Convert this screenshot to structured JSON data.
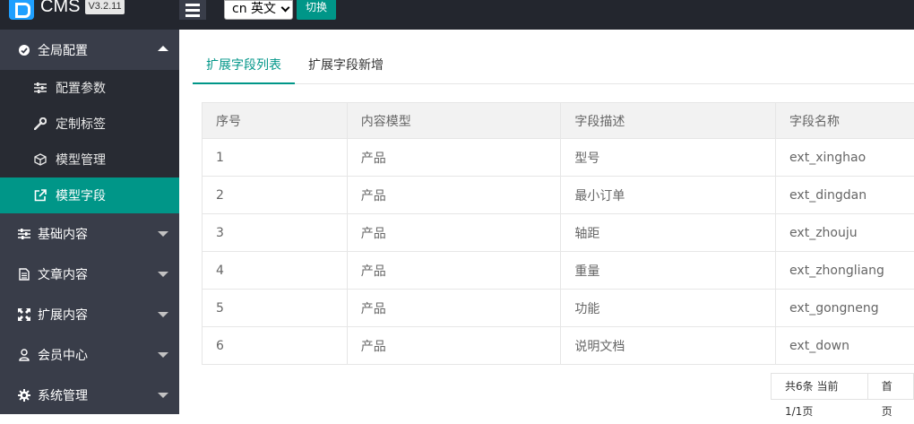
{
  "header": {
    "app_name": "CMS",
    "version": "V3.2.11",
    "language_select": "cn 英文",
    "switch_label": "切换"
  },
  "sidebar": {
    "groups": [
      {
        "label": "全局配置",
        "icon": "gear-badge-icon",
        "open": true,
        "items": [
          {
            "label": "配置参数",
            "icon": "sliders-icon"
          },
          {
            "label": "定制标签",
            "icon": "wrench-icon"
          },
          {
            "label": "模型管理",
            "icon": "cube-icon"
          },
          {
            "label": "模型字段",
            "icon": "external-link-icon",
            "active": true
          }
        ]
      },
      {
        "label": "基础内容",
        "icon": "sliders-icon"
      },
      {
        "label": "文章内容",
        "icon": "document-icon"
      },
      {
        "label": "扩展内容",
        "icon": "expand-icon"
      },
      {
        "label": "会员中心",
        "icon": "user-icon"
      },
      {
        "label": "系统管理",
        "icon": "gear-icon"
      }
    ]
  },
  "tabs": [
    {
      "label": "扩展字段列表",
      "active": true
    },
    {
      "label": "扩展字段新增",
      "active": false
    }
  ],
  "table": {
    "columns": [
      "序号",
      "内容模型",
      "字段描述",
      "字段名称"
    ],
    "rows": [
      [
        "1",
        "产品",
        "型号",
        "ext_xinghao"
      ],
      [
        "2",
        "产品",
        "最小订单",
        "ext_dingdan"
      ],
      [
        "3",
        "产品",
        "轴距",
        "ext_zhouju"
      ],
      [
        "4",
        "产品",
        "重量",
        "ext_zhongliang"
      ],
      [
        "5",
        "产品",
        "功能",
        "ext_gongneng"
      ],
      [
        "6",
        "产品",
        "说明文档",
        "ext_down"
      ]
    ]
  },
  "pager": {
    "summary": "共6条 当前1/1页",
    "first_label": "首页"
  },
  "colors": {
    "accent": "#009688",
    "sidebar_bg": "#393d49",
    "subnav_bg": "#282b33",
    "topbar_bg": "#23262e"
  }
}
